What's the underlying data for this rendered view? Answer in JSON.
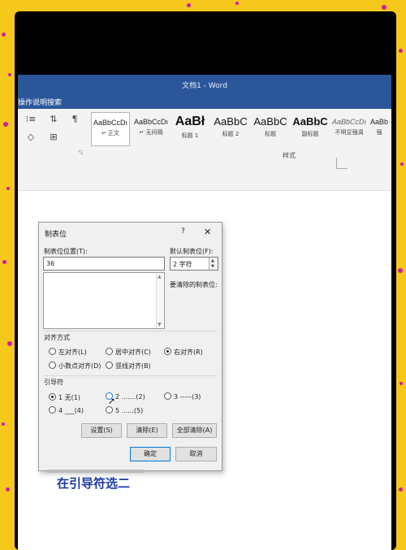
{
  "window": {
    "title": "文档1  -  Word"
  },
  "tell_me": "操作说明搜索",
  "ribbon": {
    "styles_group_label": "样式",
    "styles": [
      {
        "preview": "AaBbCcDı",
        "name": "↵ 正文",
        "selected": true
      },
      {
        "preview": "AaBbCcDı",
        "name": "↵ 无间隔",
        "selected": false
      },
      {
        "preview": "AaBł",
        "name": "标题 1",
        "selected": false
      },
      {
        "preview": "AaBbC",
        "name": "标题 2",
        "selected": false
      },
      {
        "preview": "AaBbC",
        "name": "标题",
        "selected": false
      },
      {
        "preview": "AaBbC",
        "name": "副标题",
        "selected": false
      },
      {
        "preview": "AaBbCcDı",
        "name": "不明显强调",
        "selected": false
      },
      {
        "preview": "AaBb",
        "name": "强",
        "selected": false
      }
    ]
  },
  "dialog": {
    "title": "制表位",
    "help": "?",
    "close": "✕",
    "tab_position_label": "制表位位置(T):",
    "tab_position_value": "36",
    "default_tab_label": "默认制表位(F):",
    "default_tab_value": "2 字符",
    "clear_label": "要清除的制表位:",
    "alignment_label": "对齐方式",
    "alignment_options": [
      {
        "label": "左对齐(L)",
        "checked": false
      },
      {
        "label": "居中对齐(C)",
        "checked": false
      },
      {
        "label": "右对齐(R)",
        "checked": true
      },
      {
        "label": "小数点对齐(D)",
        "checked": false
      },
      {
        "label": "竖线对齐(B)",
        "checked": false
      }
    ],
    "leader_label": "引导符",
    "leader_options": [
      {
        "label": "1 无(1)",
        "checked": true
      },
      {
        "label": "2 .......(2)",
        "checked": false
      },
      {
        "label": "3 -----(3)",
        "checked": false
      },
      {
        "label": "4 ___(4)",
        "checked": false
      },
      {
        "label": "5 ......(5)",
        "checked": false
      }
    ],
    "set_button": "设置(S)",
    "clear_button": "清除(E)",
    "clear_all_button": "全部清除(A)",
    "ok_button": "确定",
    "cancel_button": "取消"
  },
  "caption": "在引导符选二",
  "colors": {
    "background": "#f7c81c",
    "dots": "#d21aa8",
    "word_blue": "#2b579a",
    "caption": "#1b3aa8"
  }
}
